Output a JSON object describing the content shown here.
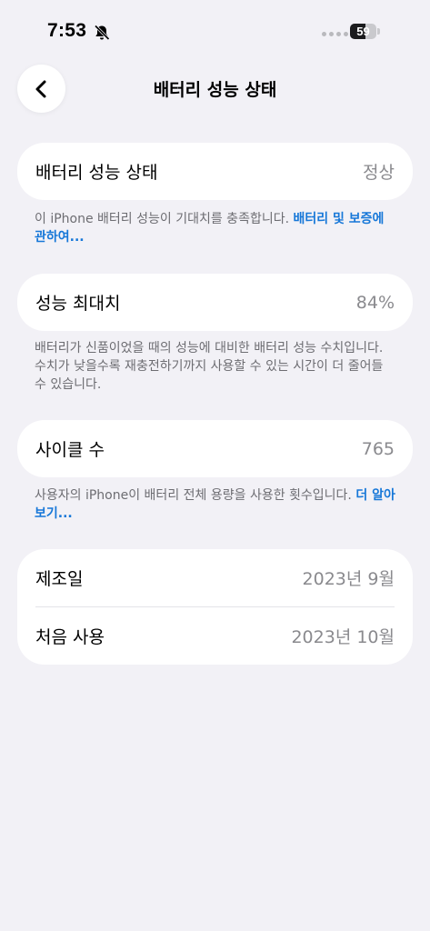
{
  "status_bar": {
    "time": "7:53",
    "battery_level": "59",
    "battery_fraction": 0.59
  },
  "nav": {
    "title": "배터리 성능 상태",
    "back_icon": "chevron-left-icon"
  },
  "battery_health": {
    "label": "배터리 성능 상태",
    "value": "정상",
    "footnote_text": "이 iPhone 배터리 성능이 기대치를 충족합니다.",
    "footnote_link": "배터리 및 보증에 관하여..."
  },
  "max_capacity": {
    "label": "성능 최대치",
    "value": "84%",
    "footnote_text": "배터리가 신품이었을 때의 성능에 대비한 배터리 성능 수치입니다. 수치가 낮을수록 재충전하기까지 사용할 수 있는 시간이 더 줄어들 수 있습니다."
  },
  "cycle_count": {
    "label": "사이클 수",
    "value": "765",
    "footnote_text": "사용자의 iPhone이 배터리 전체 용량을 사용한 횟수입니다.",
    "footnote_link": "더 알아보기..."
  },
  "dates": {
    "manufactured_label": "제조일",
    "manufactured_value": "2023년 9월",
    "first_use_label": "처음 사용",
    "first_use_value": "2023년 10월"
  },
  "colors": {
    "background": "#f2f1f6",
    "card": "#ffffff",
    "link": "#1677d8",
    "secondary_text": "#8a8a8e"
  }
}
